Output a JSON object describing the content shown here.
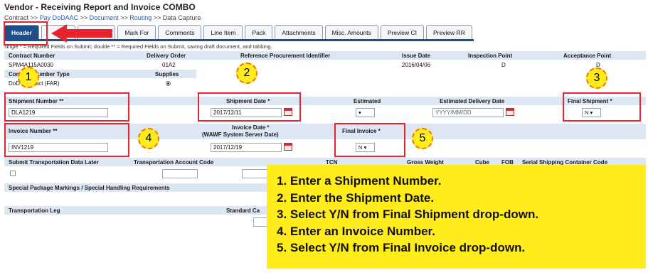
{
  "page": {
    "title": "Vendor - Receiving Report and Invoice COMBO",
    "breadcrumb": [
      "Contract",
      "Pay DoDAAC",
      "Document",
      "Routing",
      "Data Capture"
    ],
    "breadcrumb_sep": ">>",
    "note": "single * = Required Fields on Submit; double ** = Required Fields on Submit, saving draft document, and tabbing."
  },
  "tabs": [
    "Header",
    "",
    "Amounts",
    "Mark For",
    "Comments",
    "Line Item",
    "Pack",
    "Attachments",
    "Misc. Amounts",
    "Preview CI",
    "Preview RR"
  ],
  "contract": {
    "h_contract_number": "Contract Number",
    "h_delivery_order": "Delivery Order",
    "h_ref_proc_id": "Reference Procurement Identifier",
    "h_issue_date": "Issue Date",
    "h_inspection_point": "Inspection Point",
    "h_acceptance_point": "Acceptance Point",
    "contract_number": "SPM4A115A0030",
    "delivery_order": "01A2",
    "issue_date": "2016/04/06",
    "inspection_point": "D",
    "acceptance_point": "D",
    "h_contract_number_type": "Contract Number Type",
    "h_supplies": "Supplies",
    "contract_type": "DoD Contract (FAR)"
  },
  "shipment": {
    "h_shipment_number": "Shipment Number **",
    "shipment_number": "DLA1219",
    "h_shipment_date": "Shipment Date *",
    "shipment_date": "2017/12/11",
    "h_estimated": "Estimated",
    "estimated": "",
    "h_est_delivery_date": "Estimated Delivery Date",
    "est_delivery_placeholder": "YYYY/MM/DD",
    "h_final_shipment": "Final Shipment *",
    "final_shipment": "N"
  },
  "invoice": {
    "h_invoice_number": "Invoice Number **",
    "invoice_number": "INV1219",
    "h_invoice_date_1": "Invoice Date *",
    "h_invoice_date_2": "(WAWF System Server Date)",
    "invoice_date": "2017/12/19",
    "h_final_invoice": "Final Invoice *",
    "final_invoice": "N"
  },
  "transport": {
    "h_submit_later": "Submit Transportation Data Later",
    "h_transport_account": "Transportation Account Code",
    "h_tcn": "TCN",
    "h_gross_weight": "Gross Weight",
    "h_cube": "Cube",
    "h_fob": "FOB",
    "h_sscc": "Serial Shipping Container Code",
    "h_special_markings": "Special Package Markings / Special Handling Requirements",
    "h_transport_leg": "Transportation Leg",
    "h_standard_carrier": "Standard Ca"
  },
  "badges": [
    "1",
    "2",
    "3",
    "4",
    "5"
  ],
  "instructions": [
    "1.  Enter a Shipment Number.",
    "2.  Enter the Shipment Date.",
    "3.  Select Y/N from Final Shipment drop-down.",
    "4.  Enter an Invoice Number.",
    "5.  Select Y/N from Final Invoice drop-down."
  ],
  "colors": {
    "tab_active": "#1f4e8c",
    "header_row": "#dde6f3",
    "highlight_box": "#e8232d",
    "callout_bg": "#ffec1a",
    "badge_border": "#e87511"
  }
}
